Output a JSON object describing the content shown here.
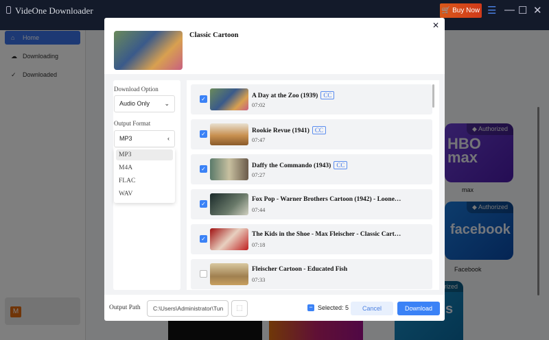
{
  "app": {
    "title": "VideOne Downloader",
    "buy_now": "Buy Now"
  },
  "sidebar": {
    "items": [
      {
        "label": "Home",
        "icon": "home-icon",
        "active": true
      },
      {
        "label": "Downloading",
        "icon": "download-cloud-icon"
      },
      {
        "label": "Downloaded",
        "icon": "check-circle-icon"
      }
    ],
    "account_initial": "M"
  },
  "background": {
    "cards": [
      {
        "badge": "Authorized",
        "logo": "HBO max",
        "label": "max"
      },
      {
        "badge": "Authorized",
        "logo": "facebook",
        "label": "Facebook"
      }
    ],
    "partial_badge": "rized",
    "partial_logo": "s"
  },
  "dialog": {
    "title": "Classic Cartoon",
    "download_option_label": "Download Option",
    "download_option_value": "Audio Only",
    "output_format_label": "Output Format",
    "output_format_value": "MP3",
    "format_options": [
      "MP3",
      "M4A",
      "FLAC",
      "WAV"
    ],
    "videos": [
      {
        "title": "A Day at the Zoo (1939)",
        "cc": "CC",
        "duration": "07:02",
        "checked": true
      },
      {
        "title": "Rookie Revue (1941)",
        "cc": "CC",
        "duration": "07:47",
        "checked": true
      },
      {
        "title": "Daffy the Commando (1943)",
        "cc": "CC",
        "duration": "07:27",
        "checked": true
      },
      {
        "title": "Fox Pop - Warner Brothers Cartoon (1942) - Loone…",
        "duration": "07:44",
        "checked": true
      },
      {
        "title": "The Kids in the Shoe - Max Fleischer - Classic Cart…",
        "duration": "07:18",
        "checked": true
      },
      {
        "title": "Fleischer Cartoon - Educated Fish",
        "duration": "07:33",
        "checked": false
      }
    ],
    "output_path_label": "Output Path",
    "output_path": "C:\\Users\\Administrator\\Tun",
    "selected": "Selected: 5",
    "cancel": "Cancel",
    "download": "Download"
  },
  "colors": {
    "accent": "#3b82f6",
    "buy": "#d9581a",
    "titlebar": "#131a2a"
  }
}
